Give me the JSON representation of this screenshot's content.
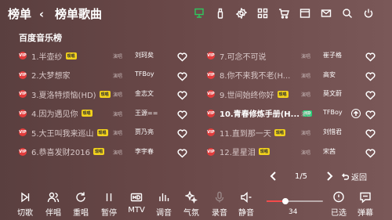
{
  "nav": {
    "title": "榜单",
    "back_glyph": "‹",
    "subtitle": "榜单歌曲"
  },
  "top_icons": [
    "screen-cast-icon",
    "usb-icon",
    "settings-icon",
    "qr-code-icon",
    "cart-icon",
    "music-library-icon",
    "message-icon",
    "search-icon",
    "power-icon"
  ],
  "section_title": "百度音乐榜",
  "songs": [
    {
      "title": "1.半壶纱",
      "badge": "现唱",
      "singer_label": "演唱",
      "singer": "刘珂矣"
    },
    {
      "title": "2.大梦想家",
      "badge": "",
      "singer_label": "演唱",
      "singer": "TFBoy"
    },
    {
      "title": "3.夏洛特烦恼(HD)",
      "badge": "现唱",
      "singer_label": "演唱",
      "singer": "金志文"
    },
    {
      "title": "4.因为遇见你",
      "badge": "现唱",
      "singer_label": "演唱",
      "singer": "王源=="
    },
    {
      "title": "5.大王叫我来巡山",
      "badge": "现唱",
      "singer_label": "演唱",
      "singer": "贾乃亮"
    },
    {
      "title": "6.恭喜发财2016",
      "badge": "现唱",
      "singer_label": "演唱",
      "singer": "李宇春"
    },
    {
      "title": "7.可念不可说",
      "badge": "",
      "singer_label": "演唱",
      "singer": "崔子格"
    },
    {
      "title": "8.你不来我不老(H...",
      "badge": "",
      "singer_label": "演唱",
      "singer": "高安"
    },
    {
      "title": "9.世间始终你好",
      "badge": "现唱",
      "singer_label": "演唱",
      "singer": "莫文蔚"
    },
    {
      "title": "10.青春修炼手册(H...",
      "badge": "HD",
      "singer_label": "演唱",
      "singer": "TFBoy"
    },
    {
      "title": "11.直到那一天",
      "badge": "现唱",
      "singer_label": "演唱",
      "singer": "刘惜君"
    },
    {
      "title": "12.星星泪",
      "badge": "现唱",
      "singer_label": "演唱",
      "singer": "宋茜"
    }
  ],
  "vip_label": "VIP",
  "pager": {
    "page": "1/5",
    "return_label": "返回"
  },
  "controls": [
    {
      "name": "skip-button",
      "label": "切歌",
      "icon": "skip-icon"
    },
    {
      "name": "accompany-button",
      "label": "伴唱",
      "icon": "people-icon"
    },
    {
      "name": "replay-button",
      "label": "重唱",
      "icon": "replay-icon"
    },
    {
      "name": "pause-button",
      "label": "暂停",
      "icon": "pause-icon"
    },
    {
      "name": "mtv-button",
      "label": "MTV",
      "icon": "hd-icon"
    },
    {
      "name": "tune-button",
      "label": "调音",
      "icon": "equalizer-icon"
    },
    {
      "name": "atmosphere-button",
      "label": "气氛",
      "icon": "sparkle-icon"
    },
    {
      "name": "record-button",
      "label": "录音",
      "icon": "microphone-icon"
    },
    {
      "name": "mute-button",
      "label": "静音",
      "icon": "speaker-mute-icon"
    },
    {
      "name": "selected-button",
      "label": "已选",
      "icon": "selected-list-icon"
    },
    {
      "name": "danmaku-button",
      "label": "弹幕",
      "icon": "comment-icon"
    }
  ],
  "volume": {
    "value": "34",
    "level": 0.34
  },
  "colors": {
    "accent": "#2ec95e",
    "vip": "#e23c3c",
    "volume_fill": "#f44a4a",
    "badge": "#f2d21c",
    "hd_badge": "#2ad07a"
  }
}
